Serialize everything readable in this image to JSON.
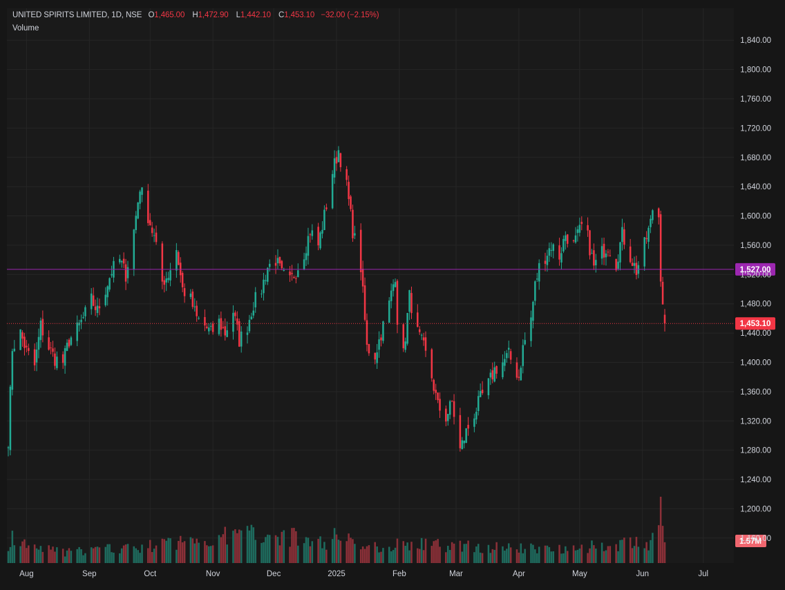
{
  "legend": {
    "symbol": "UNITED SPIRITS LIMITED, 1D, NSE",
    "o_label": "O",
    "o_value": "1,465.00",
    "h_label": "H",
    "h_value": "1,472.90",
    "l_label": "L",
    "l_value": "1,442.10",
    "c_label": "C",
    "c_value": "1,453.10",
    "change": "−32.00 (−2.15%)",
    "volume_label": "Volume"
  },
  "colors": {
    "background": "#161616",
    "up": "#22ab94",
    "down": "#f23645",
    "vol_up": "#1e6b5e",
    "vol_down": "#8c3038",
    "hline": "#9c27b0",
    "last_price": "#f23645",
    "grid": "#262626"
  },
  "chart_data": {
    "type": "candlestick",
    "title": "UNITED SPIRITS LIMITED, 1D, NSE",
    "ylim": [
      1140,
      1860
    ],
    "y_ticks": [
      "1,840.00",
      "1,800.00",
      "1,760.00",
      "1,720.00",
      "1,680.00",
      "1,640.00",
      "1,600.00",
      "1,560.00",
      "1,520.00",
      "1,480.00",
      "1,440.00",
      "1,400.00",
      "1,360.00",
      "1,320.00",
      "1,280.00",
      "1,240.00",
      "1,200.00",
      "1,160.00"
    ],
    "x_labels": [
      "Aug",
      "Sep",
      "Oct",
      "Nov",
      "Dec",
      "2025",
      "Feb",
      "Mar",
      "Apr",
      "May",
      "Jun",
      "Jul"
    ],
    "horizontal_line": {
      "value": 1527,
      "label": "1,527.00"
    },
    "last_price": {
      "value": 1453.1,
      "label": "1,453.10"
    },
    "last_volume": {
      "label": "1.57M"
    },
    "price_path": [
      [
        "2024-07-23",
        1295
      ],
      [
        "2024-07-25",
        1420
      ],
      [
        "2024-07-29",
        1440
      ],
      [
        "2024-08-01",
        1415
      ],
      [
        "2024-08-05",
        1395
      ],
      [
        "2024-08-08",
        1450
      ],
      [
        "2024-08-12",
        1420
      ],
      [
        "2024-08-15",
        1405
      ],
      [
        "2024-08-19",
        1400
      ],
      [
        "2024-08-22",
        1430
      ],
      [
        "2024-08-26",
        1445
      ],
      [
        "2024-08-29",
        1460
      ],
      [
        "2024-09-02",
        1485
      ],
      [
        "2024-09-05",
        1470
      ],
      [
        "2024-09-09",
        1500
      ],
      [
        "2024-09-12",
        1525
      ],
      [
        "2024-09-16",
        1540
      ],
      [
        "2024-09-19",
        1520
      ],
      [
        "2024-09-23",
        1580
      ],
      [
        "2024-09-26",
        1640
      ],
      [
        "2024-09-30",
        1600
      ],
      [
        "2024-10-03",
        1570
      ],
      [
        "2024-10-07",
        1510
      ],
      [
        "2024-10-10",
        1520
      ],
      [
        "2024-10-14",
        1555
      ],
      [
        "2024-10-17",
        1500
      ],
      [
        "2024-10-21",
        1485
      ],
      [
        "2024-10-24",
        1460
      ],
      [
        "2024-10-28",
        1450
      ],
      [
        "2024-10-31",
        1440
      ],
      [
        "2024-11-04",
        1455
      ],
      [
        "2024-11-07",
        1440
      ],
      [
        "2024-11-11",
        1470
      ],
      [
        "2024-11-14",
        1430
      ],
      [
        "2024-11-18",
        1450
      ],
      [
        "2024-11-21",
        1480
      ],
      [
        "2024-11-25",
        1500
      ],
      [
        "2024-11-28",
        1530
      ],
      [
        "2024-12-02",
        1540
      ],
      [
        "2024-12-05",
        1520
      ],
      [
        "2024-12-09",
        1510
      ],
      [
        "2024-12-12",
        1525
      ],
      [
        "2024-12-16",
        1550
      ],
      [
        "2024-12-19",
        1580
      ],
      [
        "2024-12-23",
        1560
      ],
      [
        "2024-12-26",
        1600
      ],
      [
        "2024-12-30",
        1660
      ],
      [
        "2025-01-02",
        1690
      ],
      [
        "2025-01-06",
        1640
      ],
      [
        "2025-01-09",
        1580
      ],
      [
        "2025-01-13",
        1530
      ],
      [
        "2025-01-16",
        1420
      ],
      [
        "2025-01-20",
        1410
      ],
      [
        "2025-01-23",
        1440
      ],
      [
        "2025-01-27",
        1480
      ],
      [
        "2025-01-30",
        1520
      ],
      [
        "2025-02-01",
        1400
      ],
      [
        "2025-02-03",
        1410
      ],
      [
        "2025-02-06",
        1490
      ],
      [
        "2025-02-10",
        1440
      ],
      [
        "2025-02-13",
        1420
      ],
      [
        "2025-02-17",
        1380
      ],
      [
        "2025-02-20",
        1340
      ],
      [
        "2025-02-24",
        1325
      ],
      [
        "2025-02-27",
        1345
      ],
      [
        "2025-03-03",
        1280
      ],
      [
        "2025-03-06",
        1305
      ],
      [
        "2025-03-10",
        1330
      ],
      [
        "2025-03-13",
        1350
      ],
      [
        "2025-03-17",
        1370
      ],
      [
        "2025-03-20",
        1390
      ],
      [
        "2025-03-24",
        1400
      ],
      [
        "2025-03-27",
        1410
      ],
      [
        "2025-04-01",
        1380
      ],
      [
        "2025-04-03",
        1420
      ],
      [
        "2025-04-07",
        1460
      ],
      [
        "2025-04-09",
        1505
      ],
      [
        "2025-04-11",
        1530
      ],
      [
        "2025-04-15",
        1550
      ],
      [
        "2025-04-17",
        1560
      ],
      [
        "2025-04-21",
        1545
      ],
      [
        "2025-04-24",
        1575
      ],
      [
        "2025-04-28",
        1560
      ],
      [
        "2025-05-02",
        1585
      ],
      [
        "2025-05-05",
        1570
      ],
      [
        "2025-05-08",
        1530
      ],
      [
        "2025-05-12",
        1550
      ],
      [
        "2025-05-15",
        1560
      ],
      [
        "2025-05-19",
        1535
      ],
      [
        "2025-05-22",
        1575
      ],
      [
        "2025-05-26",
        1545
      ],
      [
        "2025-05-29",
        1525
      ],
      [
        "2025-06-02",
        1560
      ],
      [
        "2025-06-05",
        1590
      ],
      [
        "2025-06-06",
        1610
      ],
      [
        "2025-06-09",
        1600
      ],
      [
        "2025-06-10",
        1520
      ],
      [
        "2025-06-11",
        1485
      ],
      [
        "2025-06-12",
        1453.1
      ]
    ],
    "volume_path": [
      [
        "2024-07-23",
        1.0
      ],
      [
        "2024-07-25",
        2.6
      ],
      [
        "2024-07-26",
        1.6
      ],
      [
        "2024-08-20",
        0.9
      ],
      [
        "2024-09-05",
        1.1
      ],
      [
        "2024-09-20",
        1.3
      ],
      [
        "2024-09-27",
        1.2
      ],
      [
        "2024-10-03",
        1.5
      ],
      [
        "2024-11-25",
        2.6
      ],
      [
        "2024-12-30",
        1.6
      ],
      [
        "2025-01-01",
        2.9
      ],
      [
        "2025-01-15",
        1.2
      ],
      [
        "2025-02-01",
        1.6
      ],
      [
        "2025-04-09",
        1.2
      ],
      [
        "2025-05-08",
        1.4
      ],
      [
        "2025-05-29",
        1.6
      ],
      [
        "2025-06-04",
        1.3
      ],
      [
        "2025-06-10",
        5.0
      ],
      [
        "2025-06-12",
        1.57
      ]
    ]
  }
}
